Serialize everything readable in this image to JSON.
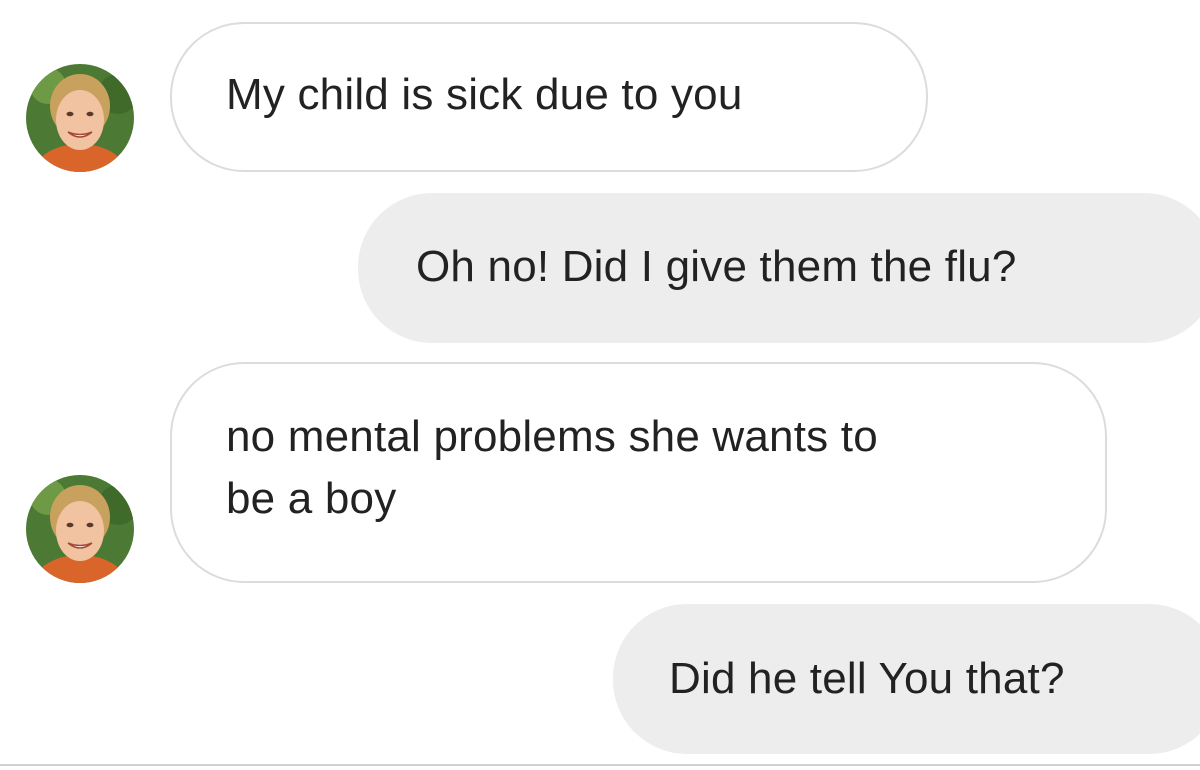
{
  "conversation": {
    "messages": [
      {
        "sender": "other",
        "text": "My child is sick due to you",
        "avatar_icon": "profile-photo-woman"
      },
      {
        "sender": "self",
        "text": "Oh no! Did I give them the flu?"
      },
      {
        "sender": "other",
        "text": "no mental problems she wants to\nbe a boy",
        "avatar_icon": "profile-photo-woman"
      },
      {
        "sender": "self",
        "text": "Did he tell You that?"
      }
    ]
  },
  "colors": {
    "background": "#ffffff",
    "incoming_bubble_fill": "#ffffff",
    "incoming_bubble_border": "#dcdcdc",
    "outgoing_bubble_fill": "#ededed",
    "text": "#222222"
  }
}
